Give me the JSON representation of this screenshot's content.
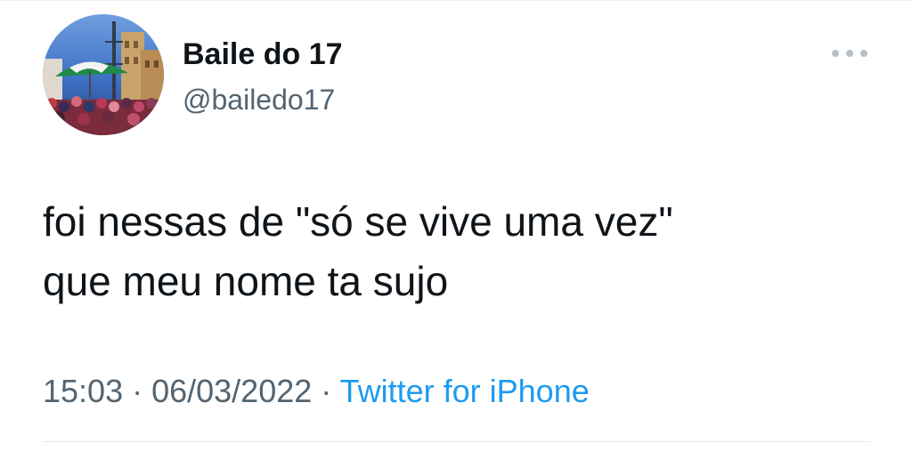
{
  "profile": {
    "display_name": "Baile do 17",
    "handle": "@bailedo17"
  },
  "more_icon": "more-horizontal-icon",
  "tweet": {
    "lines": [
      "foi nessas de \"só se vive uma vez\"",
      "que meu nome ta sujo"
    ]
  },
  "meta": {
    "time": "15:03",
    "separator_1": " · ",
    "date": "06/03/2022",
    "separator_2": " · ",
    "source": "Twitter for iPhone"
  },
  "colors": {
    "text_primary": "#0f1419",
    "text_secondary": "#536471",
    "link": "#1d9bf0"
  }
}
